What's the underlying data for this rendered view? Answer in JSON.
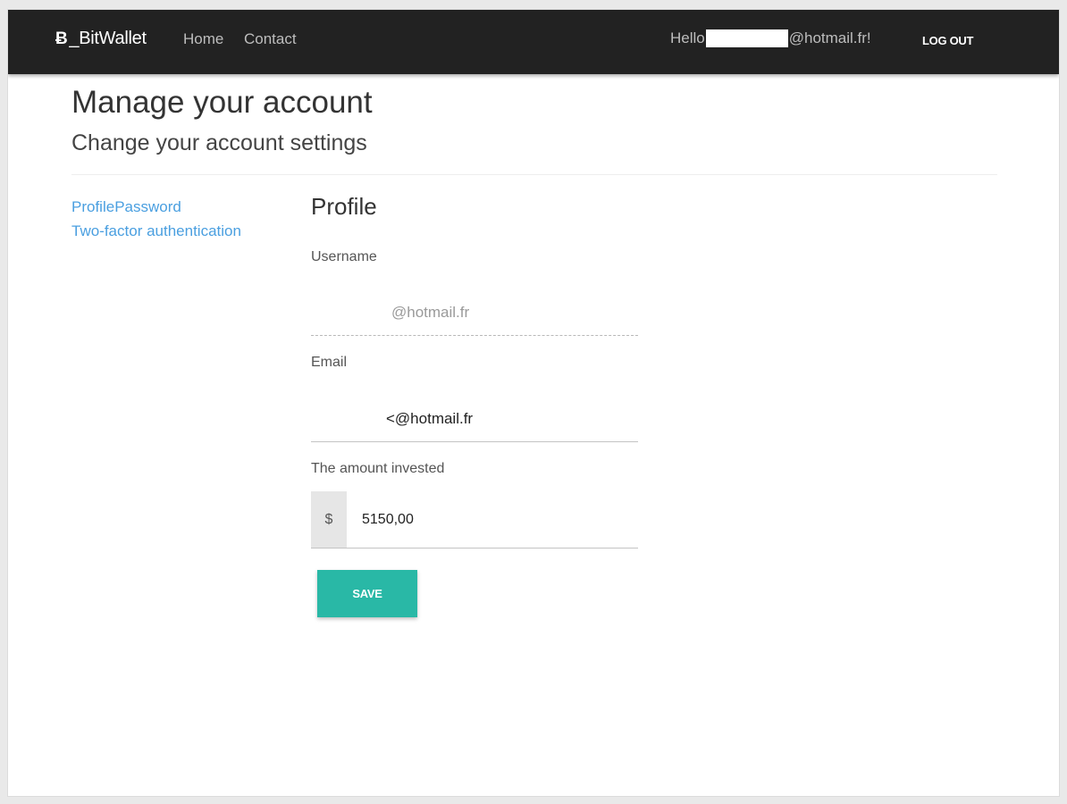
{
  "navbar": {
    "brand": {
      "icon": "bitcoin-icon",
      "icon_glyph": "Ƀ",
      "label": "_BitWallet"
    },
    "links": {
      "home": "Home",
      "contact": "Contact"
    },
    "greeting": {
      "prefix": "Hello",
      "suffix": "@hotmail.fr!"
    },
    "logout_label": "LOG OUT"
  },
  "page": {
    "title": "Manage your account",
    "subtitle": "Change your account settings"
  },
  "side_nav": {
    "profile_label": "Profile",
    "password_label": "Password",
    "two_factor_label": "Two-factor authentication"
  },
  "profile": {
    "heading": "Profile",
    "username": {
      "label": "Username",
      "value": "@hotmail.fr"
    },
    "email": {
      "label": "Email",
      "value": "<@hotmail.fr"
    },
    "amount": {
      "label": "The amount invested",
      "currency": "$",
      "value": "5150,00"
    },
    "save_label": "SAVE"
  },
  "colors": {
    "navbar_bg": "#222222",
    "link": "#4a9fe0",
    "save_button": "#29b8a6"
  }
}
